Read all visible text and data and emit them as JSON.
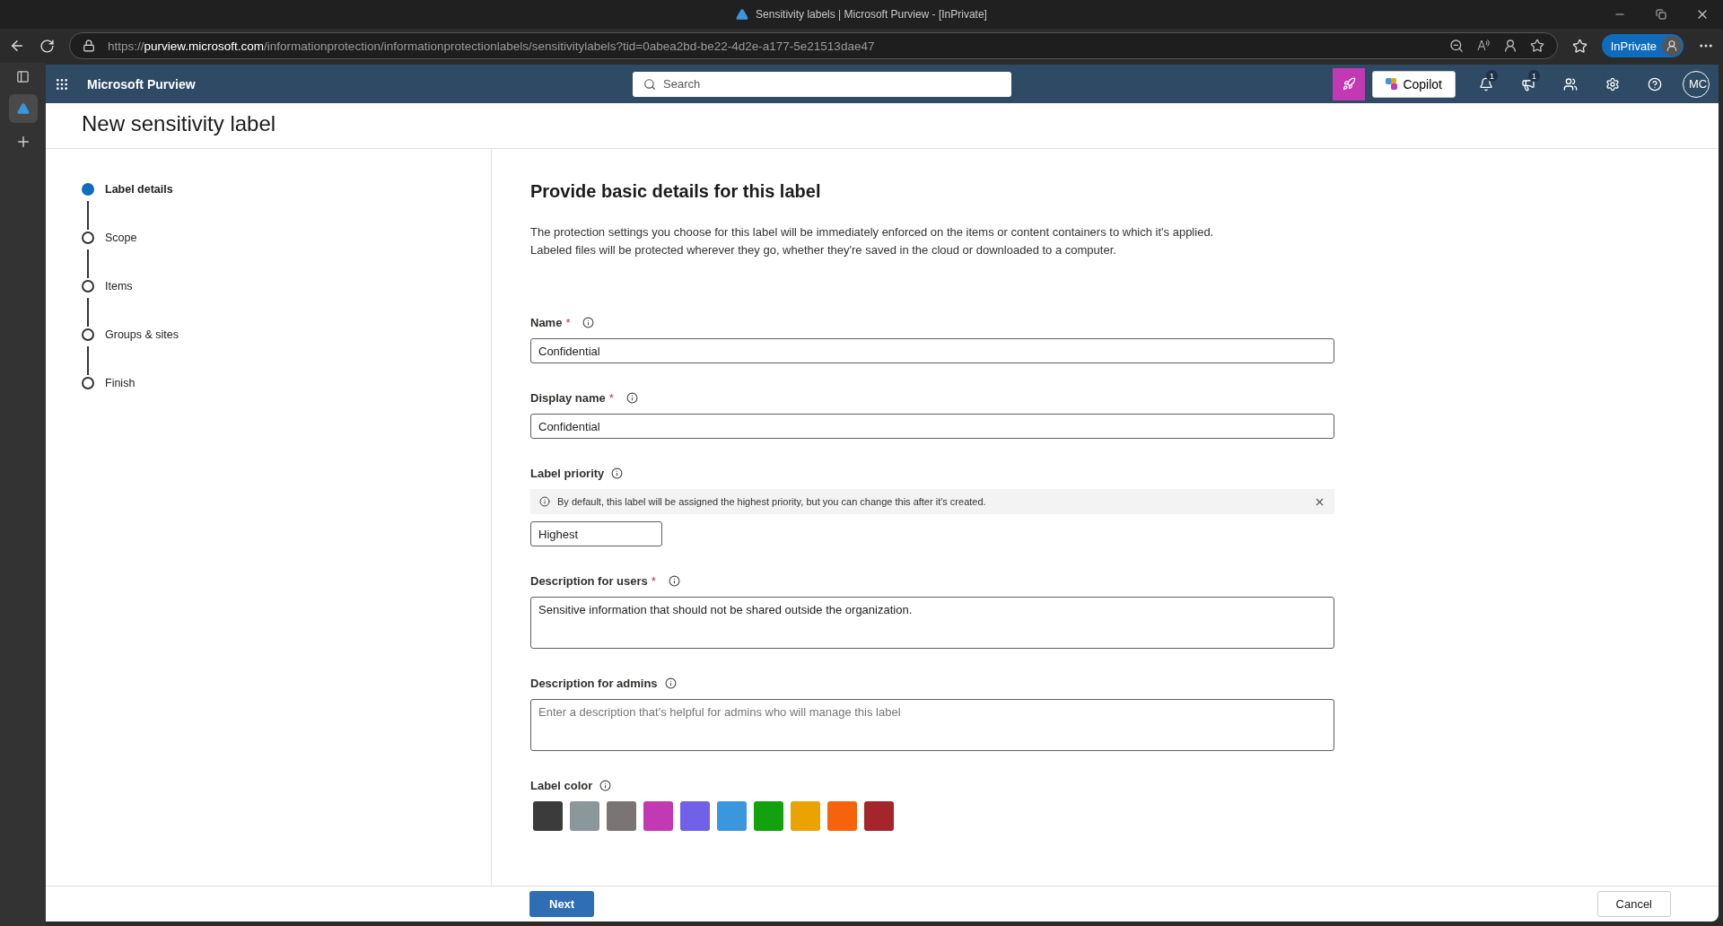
{
  "browser": {
    "tab_title": "Sensitivity labels | Microsoft Purview - [InPrivate]",
    "url": {
      "scheme": "https://",
      "host": "purview.microsoft.com",
      "path": "/informationprotection/informationprotectionlabels/sensitivitylabels?tid=0abea2bd-be22-4d2e-a177-5e21513dae47"
    },
    "inprivate": "InPrivate"
  },
  "app": {
    "name": "Microsoft Purview",
    "search_placeholder": "Search",
    "copilot": "Copilot",
    "notification_badge": "1",
    "news_badge": "1",
    "avatar": "MC"
  },
  "page": {
    "title": "New sensitivity label"
  },
  "steps": [
    {
      "label": "Label details",
      "selected": true
    },
    {
      "label": "Scope",
      "selected": false
    },
    {
      "label": "Items",
      "selected": false
    },
    {
      "label": "Groups & sites",
      "selected": false
    },
    {
      "label": "Finish",
      "selected": false
    }
  ],
  "form": {
    "heading": "Provide basic details for this label",
    "intro": [
      "The protection settings you choose for this label will be immediately enforced on the items or content containers to which it's applied.",
      "Labeled files will be protected wherever they go, whether they're saved in the cloud or downloaded to a computer."
    ],
    "fields": [
      {
        "kind": "text",
        "label": "Name",
        "required_mark": "*",
        "value": "Confidential"
      },
      {
        "kind": "text",
        "label": "Display name",
        "required_mark": "*",
        "value": "Confidential"
      },
      {
        "kind": "priority",
        "label": "Label priority",
        "notice": "By default, this label will be assigned the highest priority, but you can change this after it's created.",
        "value": "Highest"
      },
      {
        "kind": "textarea",
        "label": "Description for users",
        "required_mark": "*",
        "value": "Sensitive information that should not be shared outside the organization."
      },
      {
        "kind": "textarea",
        "label": "Description for admins",
        "placeholder": "Enter a description that's helpful for admins who will manage this label"
      },
      {
        "kind": "colors",
        "label": "Label color",
        "colors": [
          {
            "color": "#3b3b3b"
          },
          {
            "color": "#8a979b"
          },
          {
            "color": "#7a7574"
          },
          {
            "color": "#c239b3"
          },
          {
            "color": "#7160e8"
          },
          {
            "color": "#3a96dd"
          },
          {
            "color": "#13a10e"
          },
          {
            "color": "#eaa300"
          },
          {
            "color": "#f7630c"
          },
          {
            "color": "#a4262c"
          }
        ]
      }
    ]
  },
  "footer": {
    "next": "Next",
    "cancel": "Cancel"
  }
}
